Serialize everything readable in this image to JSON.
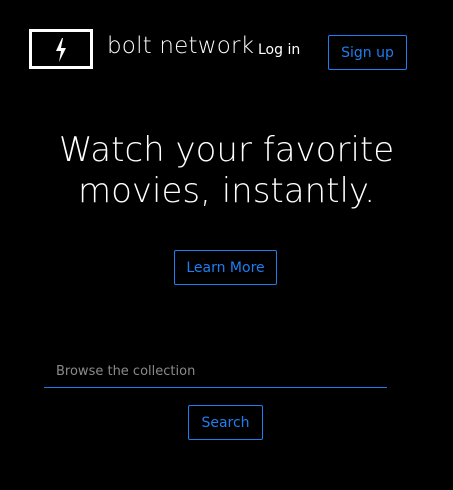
{
  "header": {
    "brand_name": "bolt network",
    "login_label": "Log in",
    "signup_label": "Sign up",
    "logo_icon": "lightning-bolt-icon"
  },
  "hero": {
    "line1": "Watch your favorite",
    "line2": "movies, instantly.",
    "learn_more_label": "Learn More"
  },
  "search": {
    "placeholder": "Browse the collection",
    "value": "",
    "button_label": "Search"
  },
  "colors": {
    "background": "#000000",
    "text": "#ffffff",
    "accent": "#1e7ef0",
    "placeholder": "#8a8a8a"
  }
}
